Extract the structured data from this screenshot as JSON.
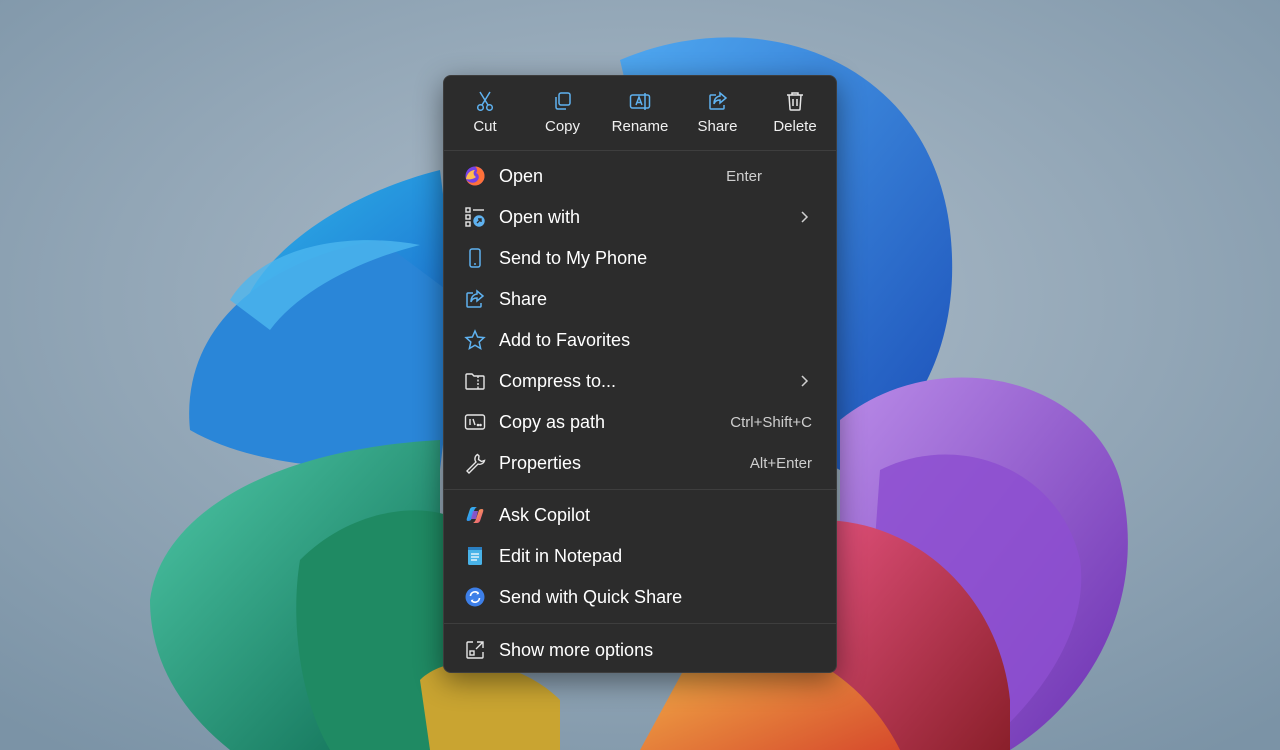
{
  "colors": {
    "menu_bg": "#2c2c2c",
    "accent_blue": "#5fb2f0",
    "text": "#ffffff"
  },
  "toolbar": {
    "cut_label": "Cut",
    "copy_label": "Copy",
    "rename_label": "Rename",
    "share_label": "Share",
    "delete_label": "Delete"
  },
  "items": {
    "open": {
      "label": "Open",
      "shortcut": "Enter",
      "icon": "firefox-icon"
    },
    "open_with": {
      "label": "Open with",
      "icon": "open-with-icon"
    },
    "send_phone": {
      "label": "Send to My Phone",
      "icon": "phone-icon"
    },
    "share": {
      "label": "Share",
      "icon": "share-icon"
    },
    "favorites": {
      "label": "Add to Favorites",
      "icon": "star-icon"
    },
    "compress": {
      "label": "Compress to...",
      "icon": "zip-folder-icon"
    },
    "copy_path": {
      "label": "Copy as path",
      "shortcut": "Ctrl+Shift+C",
      "icon": "copy-path-icon"
    },
    "properties": {
      "label": "Properties",
      "shortcut": "Alt+Enter",
      "icon": "wrench-icon"
    },
    "copilot": {
      "label": "Ask Copilot",
      "icon": "copilot-icon"
    },
    "notepad": {
      "label": "Edit in Notepad",
      "icon": "notepad-icon"
    },
    "quick_share": {
      "label": "Send with Quick Share",
      "icon": "quick-share-icon"
    },
    "more_options": {
      "label": "Show more options",
      "icon": "more-options-icon"
    }
  }
}
